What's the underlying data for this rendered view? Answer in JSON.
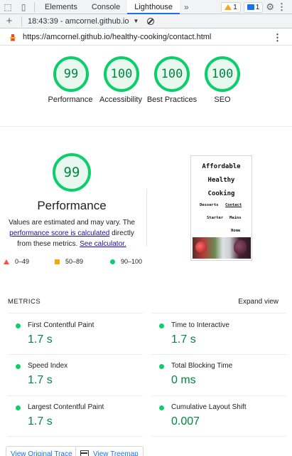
{
  "devtools": {
    "tabs": [
      "Elements",
      "Console",
      "Lighthouse"
    ],
    "active_tab": "Lighthouse",
    "more_tabs": "»",
    "warnings_count": "1",
    "messages_count": "1"
  },
  "report_selector": {
    "label": "18:43:39 - amcornel.github.io"
  },
  "url": "https://amcornel.github.io/healthy-cooking/contact.html",
  "scores": [
    {
      "value": "99",
      "label": "Performance"
    },
    {
      "value": "100",
      "label": "Accessibility"
    },
    {
      "value": "100",
      "label": "Best Practices"
    },
    {
      "value": "100",
      "label": "SEO"
    }
  ],
  "performance": {
    "score": "99",
    "title": "Performance",
    "desc_1": "Values are estimated and may vary. The",
    "desc_link_1": "performance score is calculated",
    "desc_2": " directly from these metrics. ",
    "desc_link_2": "See calculator."
  },
  "legend": {
    "fail": "0–49",
    "average": "50–89",
    "pass": "90–100"
  },
  "thumbnail": {
    "title_1": "Affordable",
    "title_2": "Healthy",
    "title_3": "Cooking",
    "nav_1": "Desserts",
    "nav_2": "Contact",
    "nav_3": "Starter",
    "nav_4": "Mains",
    "nav_5": "Home"
  },
  "metrics": {
    "heading": "METRICS",
    "expand_label": "Expand view",
    "items": [
      {
        "name": "First Contentful Paint",
        "value": "1.7 s"
      },
      {
        "name": "Time to Interactive",
        "value": "1.7 s"
      },
      {
        "name": "Speed Index",
        "value": "1.7 s"
      },
      {
        "name": "Total Blocking Time",
        "value": "0 ms"
      },
      {
        "name": "Largest Contentful Paint",
        "value": "1.7 s"
      },
      {
        "name": "Cumulative Layout Shift",
        "value": "0.007"
      }
    ]
  },
  "buttons": {
    "original_trace": "View Original Trace",
    "treemap": "View Treemap"
  },
  "colors": {
    "pass": "#0cce6b",
    "pass_text": "#018642",
    "average": "#ffa400",
    "fail": "#ff4e42",
    "link": "#1a73e8"
  }
}
